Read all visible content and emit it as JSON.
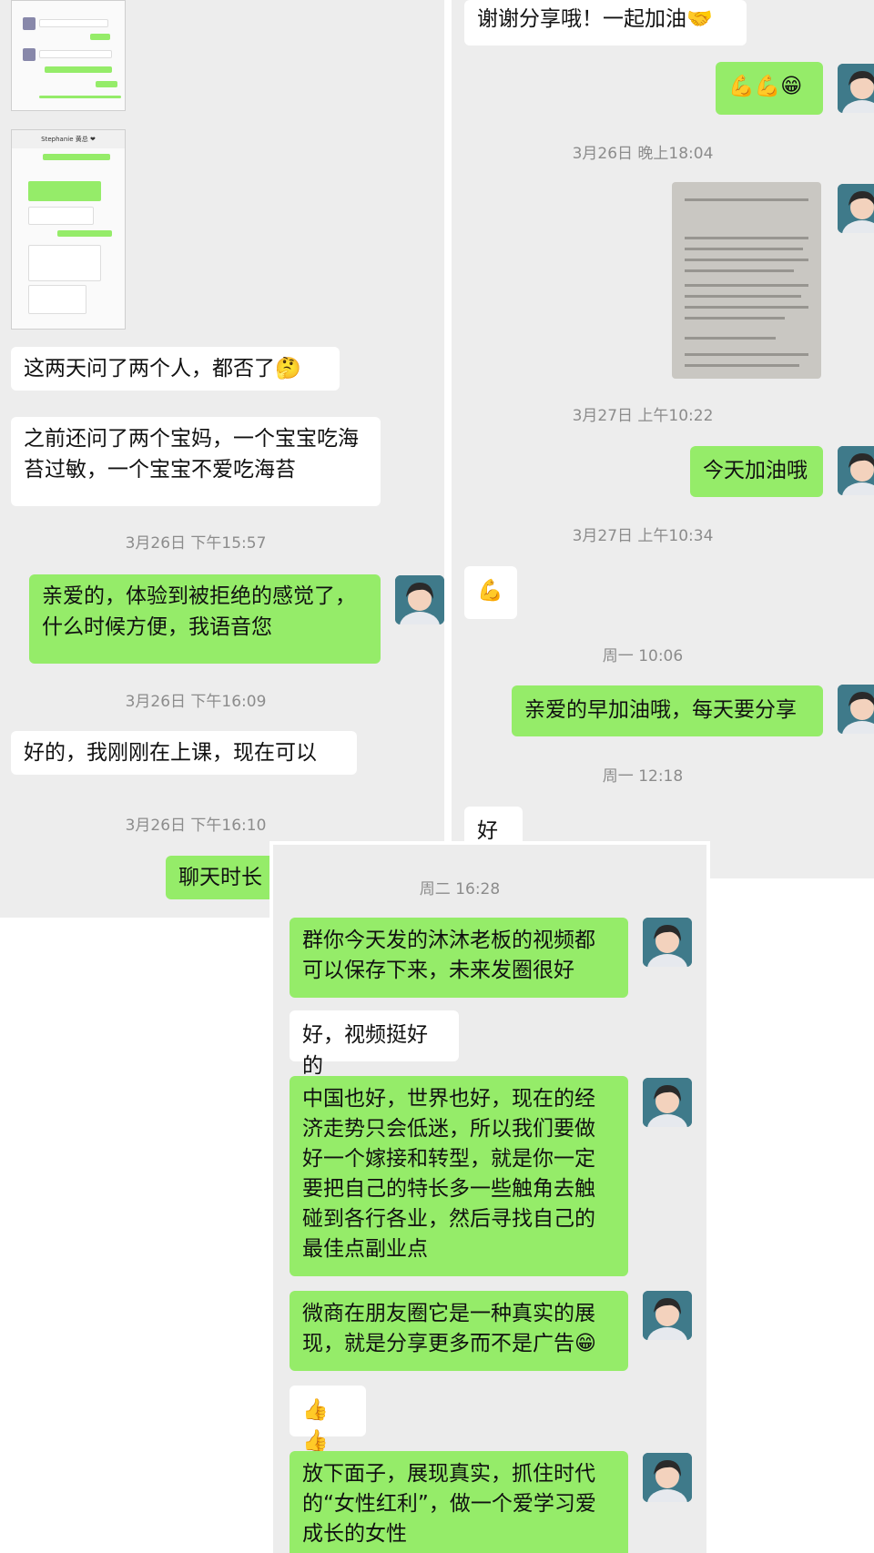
{
  "left": {
    "messages": [
      {
        "text": "这两天问了两个人，都否了🤔"
      },
      {
        "text": "之前还问了两个宝妈，一个宝宝吃海苔过敏，一个宝宝不爱吃海苔"
      },
      {
        "ts": "3月26日 下午15:57"
      },
      {
        "text": "亲爱的，体验到被拒绝的感觉了，什么时候方便，我语音您"
      },
      {
        "ts": "3月26日 下午16:09"
      },
      {
        "text": "好的，我刚刚在上课，现在可以"
      },
      {
        "ts": "3月26日 下午16:10"
      },
      {
        "text": "聊天时长"
      }
    ],
    "thumbnail": {
      "header": "Stephanie 黄总 ❤"
    }
  },
  "right": {
    "messages": [
      {
        "text": "谢谢分享哦！一起加油🤝"
      },
      {
        "text": "💪💪😁"
      },
      {
        "ts": "3月26日 晚上18:04"
      },
      {
        "ts": "3月27日 上午10:22"
      },
      {
        "text": "今天加油哦"
      },
      {
        "ts": "3月27日 上午10:34"
      },
      {
        "text": "💪"
      },
      {
        "ts": "周一 10:06"
      },
      {
        "text": "亲爱的早加油哦，每天要分享"
      },
      {
        "ts": "周一 12:18"
      },
      {
        "text": "好的"
      }
    ]
  },
  "bottom": {
    "messages": [
      {
        "ts": "周二 16:28"
      },
      {
        "text": "群你今天发的沐沐老板的视频都可以保存下来，未来发圈很好"
      },
      {
        "text": "好，视频挺好的"
      },
      {
        "text": "中国也好，世界也好，现在的经济走势只会低迷，所以我们要做好一个嫁接和转型，就是你一定要把自己的特长多一些触角去触碰到各行各业，然后寻找自己的最佳点副业点"
      },
      {
        "text": "微商在朋友圈它是一种真实的展现，就是分享更多而不是广告😁"
      },
      {
        "text": "👍👍"
      },
      {
        "text": "放下面子，展现真实，抓住时代的“女性红利”，做一个爱学习爱成长的女性"
      }
    ]
  },
  "colors": {
    "outgoing_bubble": "#95ec69",
    "incoming_bubble": "#ffffff",
    "chat_bg": "#ededed"
  }
}
